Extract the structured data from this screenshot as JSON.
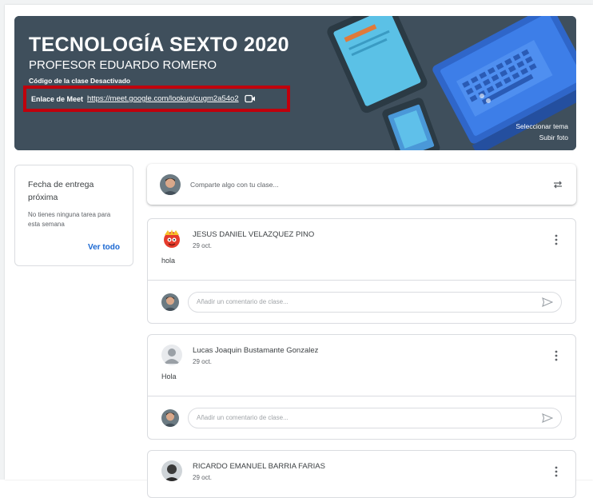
{
  "banner": {
    "title": "TECNOLOGÍA SEXTO 2020",
    "subtitle": "PROFESOR EDUARDO ROMERO",
    "class_code": "Código de la clase  Desactivado",
    "meet_label": "Enlace de Meet",
    "meet_link": "https://meet.google.com/lookup/cugm2a54o2",
    "select_theme": "Seleccionar tema",
    "upload_photo": "Subir foto",
    "highlight_color": "#c0000c",
    "background_color": "#3f4f5c"
  },
  "upcoming": {
    "title": "Fecha de entrega próxima",
    "empty_text": "No tienes ninguna tarea para esta semana",
    "view_all": "Ver todo"
  },
  "share": {
    "placeholder": "Comparte algo con tu clase...",
    "icon": "repost-icon"
  },
  "posts": [
    {
      "author": "JESUS DANIEL VELAZQUEZ PINO",
      "date": "29 oct.",
      "body": "hola",
      "comment_placeholder": "Añadir un comentario de clase..."
    },
    {
      "author": "Lucas Joaquin Bustamante Gonzalez",
      "date": "29 oct.",
      "body": "Hola",
      "comment_placeholder": "Añadir un comentario de clase..."
    },
    {
      "author": "RICARDO EMANUEL BARRIA FARIAS",
      "date": "29 oct."
    }
  ],
  "colors": {
    "link_blue": "#1967d2",
    "border": "#dadce0"
  }
}
